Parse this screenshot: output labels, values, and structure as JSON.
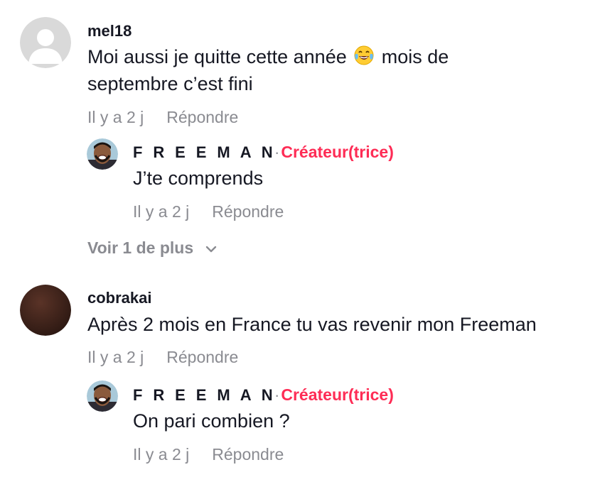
{
  "comments": [
    {
      "username": "mel18",
      "text_line1": "Moi aussi je quitte cette année",
      "emoji": "😂",
      "text_line1_end": "mois de",
      "text_line2": "septembre c’est fini",
      "time": "Il y a 2 j",
      "reply_label": "Répondre",
      "reply": {
        "username": "F R E E M A N",
        "separator": "·",
        "creator_badge": "Créateur(trice)",
        "text": "J’te comprends",
        "time": "Il y a 2 j",
        "reply_label": "Répondre"
      },
      "view_more": "Voir 1 de plus"
    },
    {
      "username": "cobrakai",
      "text": "Après 2 mois en France tu vas revenir mon Freeman",
      "time": "Il y a 2 j",
      "reply_label": "Répondre",
      "reply": {
        "username": "F R E E M A N",
        "separator": "·",
        "creator_badge": "Créateur(trice)",
        "text": "On pari combien ?",
        "time": "Il y a 2 j",
        "reply_label": "Répondre"
      }
    }
  ],
  "colors": {
    "text": "#161823",
    "muted": "#8a8b91",
    "creator": "#fe2c55",
    "default_avatar_bg": "#d9d9d9",
    "cobrakai_avatar": "#3d2219"
  },
  "icons": {
    "default_avatar": "default-avatar-icon",
    "chevron": "chevron-down-icon",
    "emoji": "face-with-tears-of-joy"
  }
}
